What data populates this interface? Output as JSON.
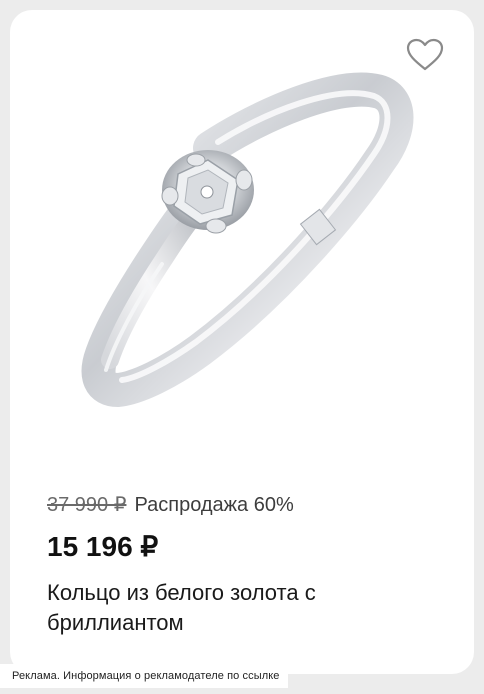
{
  "card": {
    "old_price": "37 990 ₽",
    "sale_label": "Распродажа 60%",
    "price": "15 196 ₽",
    "title": "Кольцо из белого золота с бриллиантом",
    "favorite_icon": "heart-outline-icon",
    "image_alt": "ring-image"
  },
  "ad_note": "Реклама. Информация о рекламодателе по ссылке",
  "colors": {
    "background": "#ececec",
    "card": "#ffffff",
    "price": "#111111",
    "old_price": "#6a6a6a"
  }
}
